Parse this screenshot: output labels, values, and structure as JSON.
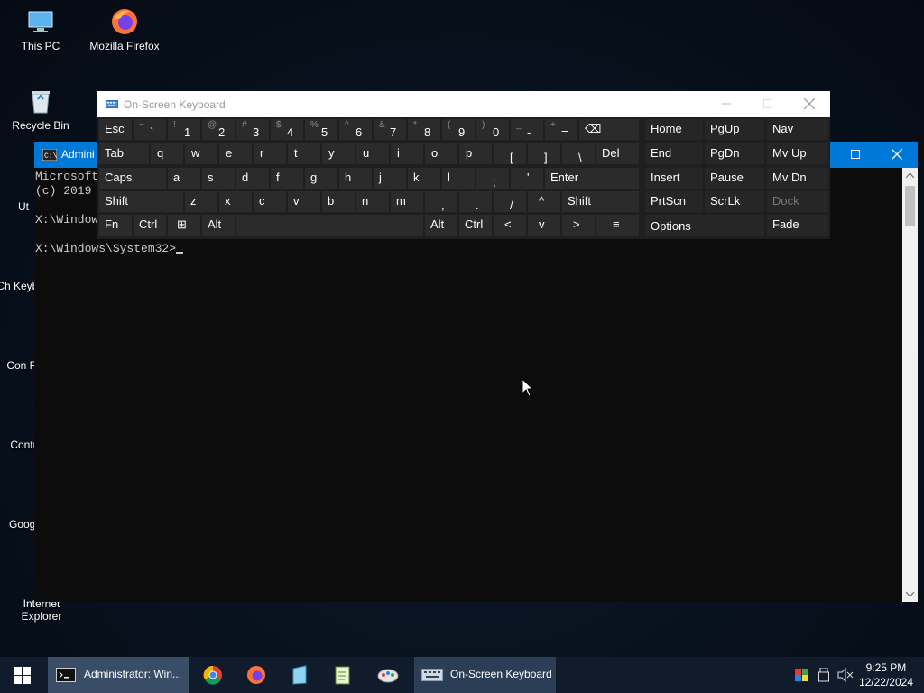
{
  "desktop": {
    "icons": [
      {
        "label": "This PC"
      },
      {
        "label": "Mozilla Firefox"
      },
      {
        "label": "Recycle Bin"
      },
      {
        "label": "Ut"
      },
      {
        "label": "Ch Keyboa"
      },
      {
        "label": "Con Pr"
      },
      {
        "label": "Contr"
      },
      {
        "label": "Googl"
      },
      {
        "label": "Internet Explorer"
      }
    ]
  },
  "console": {
    "title": "Admini",
    "lines": [
      "Microsoft",
      "(c) 2019",
      "",
      "X:\\Window",
      "",
      "X:\\Windows\\System32>"
    ]
  },
  "osk": {
    "title": "On-Screen Keyboard",
    "row1": [
      {
        "label": "Esc"
      },
      {
        "shift": "~",
        "main": "`"
      },
      {
        "shift": "!",
        "main": "1"
      },
      {
        "shift": "@",
        "main": "2"
      },
      {
        "shift": "#",
        "main": "3"
      },
      {
        "shift": "$",
        "main": "4"
      },
      {
        "shift": "%",
        "main": "5"
      },
      {
        "shift": "^",
        "main": "6"
      },
      {
        "shift": "&",
        "main": "7"
      },
      {
        "shift": "*",
        "main": "8"
      },
      {
        "shift": "(",
        "main": "9"
      },
      {
        "shift": ")",
        "main": "0"
      },
      {
        "shift": "_",
        "main": "-"
      },
      {
        "shift": "+",
        "main": "="
      },
      {
        "label": "⌫"
      }
    ],
    "row2": [
      "Tab",
      "q",
      "w",
      "e",
      "r",
      "t",
      "y",
      "u",
      "i",
      "o",
      "p",
      "[",
      "]",
      "\\",
      "Del"
    ],
    "row3": [
      "Caps",
      "a",
      "s",
      "d",
      "f",
      "g",
      "h",
      "j",
      "k",
      "l",
      ";",
      "'",
      "Enter"
    ],
    "row4": [
      "Shift",
      "z",
      "x",
      "c",
      "v",
      "b",
      "n",
      "m",
      ",",
      ".",
      "/",
      "^",
      "Shift"
    ],
    "row5": [
      "Fn",
      "Ctrl",
      "⊞",
      "Alt",
      "",
      "Alt",
      "Ctrl",
      "<",
      "v",
      ">",
      "≡"
    ],
    "nav": {
      "home": "Home",
      "pgup": "PgUp",
      "nav": "Nav",
      "end": "End",
      "pgdn": "PgDn",
      "mvup": "Mv Up",
      "insert": "Insert",
      "pause": "Pause",
      "mvdn": "Mv Dn",
      "prtscn": "PrtScn",
      "scrlk": "ScrLk",
      "dock": "Dock",
      "options": "Options",
      "fade": "Fade"
    }
  },
  "taskbar": {
    "items": [
      {
        "label": "Administrator: Win..."
      },
      {
        "label": "On-Screen Keyboard"
      }
    ],
    "time": "9:25 PM",
    "date": "12/22/2024"
  },
  "colors": {
    "accent": "#0078d7",
    "taskbar": "#101b2b",
    "osk_key": "#2b2b2b"
  }
}
